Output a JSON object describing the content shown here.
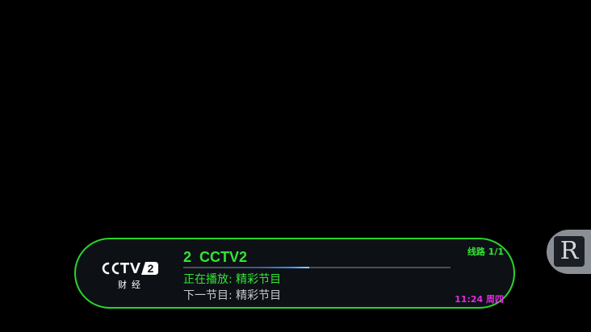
{
  "info_bar": {
    "channel_number": "2",
    "channel_name": "CCTV2",
    "channel_title": "2  CCTV2",
    "now_playing": "正在播放: 精彩节目",
    "next_program": "下一节目: 精彩节目",
    "line": "线路 1/1",
    "clock": "11:24 周四",
    "progress": 0.47
  },
  "logo": {
    "text": "CCTV 2",
    "subtitle": "财经"
  },
  "side_button": {
    "glyph": "R",
    "icon": "r-icon"
  },
  "colors": {
    "accent_green": "#2bd42b",
    "clock_magenta": "#e02be0",
    "progress_blue": "#3f8df2"
  }
}
